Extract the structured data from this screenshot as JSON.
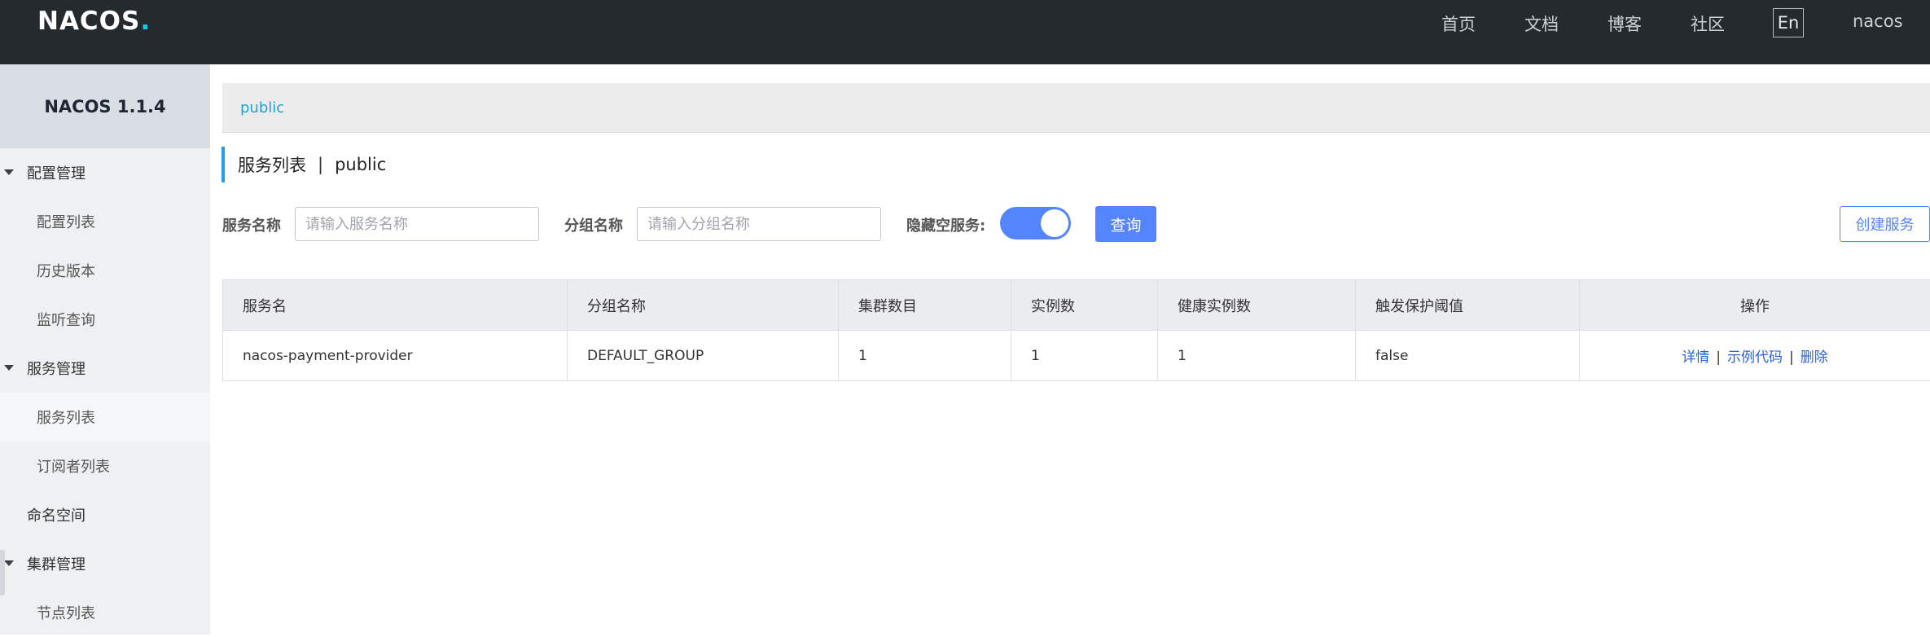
{
  "header": {
    "logo_main": "NACOS",
    "logo_dot": ".",
    "nav": [
      "首页",
      "文档",
      "博客",
      "社区"
    ],
    "lang": "En",
    "user": "nacos"
  },
  "sidebar": {
    "title": "NACOS 1.1.4",
    "items": [
      {
        "label": "配置管理",
        "type": "group"
      },
      {
        "label": "配置列表",
        "type": "sub"
      },
      {
        "label": "历史版本",
        "type": "sub"
      },
      {
        "label": "监听查询",
        "type": "sub"
      },
      {
        "label": "服务管理",
        "type": "group"
      },
      {
        "label": "服务列表",
        "type": "sub",
        "active": true
      },
      {
        "label": "订阅者列表",
        "type": "sub"
      },
      {
        "label": "命名空间",
        "type": "plain"
      },
      {
        "label": "集群管理",
        "type": "group"
      },
      {
        "label": "节点列表",
        "type": "sub"
      }
    ]
  },
  "namespace": {
    "current": "public"
  },
  "page": {
    "title": "服务列表",
    "separator": "|",
    "namespace": "public"
  },
  "filters": {
    "service_label": "服务名称",
    "service_placeholder": "请输入服务名称",
    "group_label": "分组名称",
    "group_placeholder": "请输入分组名称",
    "hide_empty_label": "隐藏空服务:",
    "hide_empty_on": true,
    "query_button": "查询",
    "create_button": "创建服务"
  },
  "table": {
    "columns": [
      "服务名",
      "分组名称",
      "集群数目",
      "实例数",
      "健康实例数",
      "触发保护阈值",
      "操作"
    ],
    "rows": [
      {
        "service": "nacos-payment-provider",
        "group": "DEFAULT_GROUP",
        "clusters": "1",
        "instances": "1",
        "healthy": "1",
        "threshold": "false",
        "ops": [
          "详情",
          "示例代码",
          "删除"
        ],
        "op_sep": "|"
      }
    ]
  },
  "colors": {
    "header_bg": "#252a2f",
    "accent": "#5584ff",
    "link": "#2a63d4",
    "namespace_link": "#1ba3d6"
  }
}
